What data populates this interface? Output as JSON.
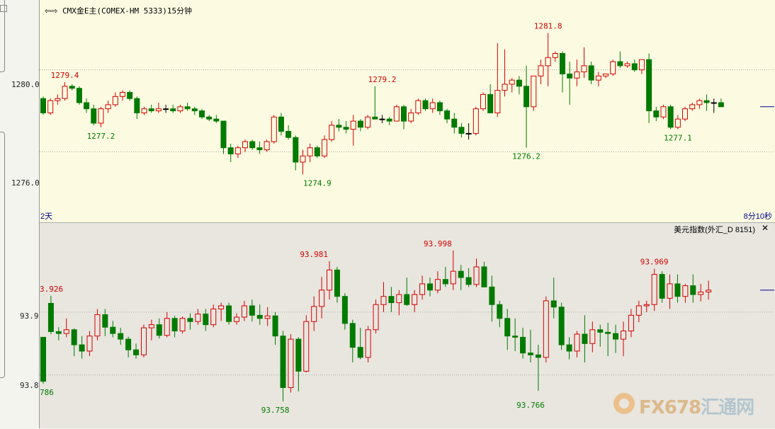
{
  "header": {
    "nav_icon": "left-right-arrows-icon",
    "instrument": "CMX金E主(COMEX-HM 5333)15分钟",
    "period_left": "2天",
    "countdown": "8分10秒"
  },
  "subchart": {
    "title": "美元指数(外汇_D 8151)",
    "close_icon": "close-icon"
  },
  "watermark": {
    "text_a": "FX678",
    "text_b": "汇通网"
  },
  "colors": {
    "up": "#d40000",
    "down": "#007a00",
    "grid": "#aaaaaa",
    "lastline": "#00008b"
  },
  "chart_data": [
    {
      "type": "candlestick",
      "name": "CMX金E主",
      "y_ticks": [
        "1280.0",
        "1276.0"
      ],
      "y_tick_values": [
        1280.0,
        1276.0
      ],
      "ylim": [
        1273.6,
        1283.2
      ],
      "grid": true,
      "annotations": [
        {
          "text": "1279.4",
          "index": 3,
          "value": 1279.4,
          "kind": "high"
        },
        {
          "text": "1277.2",
          "index": 8,
          "value": 1277.2,
          "kind": "low"
        },
        {
          "text": "1274.9",
          "index": 38,
          "value": 1274.9,
          "kind": "low"
        },
        {
          "text": "1279.2",
          "index": 47,
          "value": 1279.2,
          "kind": "high"
        },
        {
          "text": "1276.2",
          "index": 67,
          "value": 1276.2,
          "kind": "low"
        },
        {
          "text": "1281.8",
          "index": 70,
          "value": 1281.8,
          "kind": "high"
        },
        {
          "text": "1277.1",
          "index": 88,
          "value": 1277.1,
          "kind": "low"
        }
      ],
      "ohlc": [
        [
          1278.6,
          1278.7,
          1277.8,
          1277.9
        ],
        [
          1277.9,
          1278.6,
          1277.8,
          1278.5
        ],
        [
          1278.5,
          1278.8,
          1278.3,
          1278.6
        ],
        [
          1278.6,
          1279.4,
          1278.5,
          1279.2
        ],
        [
          1279.2,
          1279.3,
          1279.0,
          1279.1
        ],
        [
          1279.1,
          1279.2,
          1278.3,
          1278.4
        ],
        [
          1278.4,
          1278.6,
          1277.9,
          1278.1
        ],
        [
          1278.1,
          1278.3,
          1277.3,
          1277.4
        ],
        [
          1277.4,
          1278.2,
          1277.2,
          1278.1
        ],
        [
          1278.1,
          1278.5,
          1277.9,
          1278.3
        ],
        [
          1278.3,
          1278.9,
          1278.2,
          1278.7
        ],
        [
          1278.7,
          1279.0,
          1278.5,
          1278.9
        ],
        [
          1278.9,
          1279.0,
          1278.5,
          1278.6
        ],
        [
          1278.6,
          1278.7,
          1277.6,
          1277.9
        ],
        [
          1277.9,
          1278.2,
          1277.8,
          1278.1
        ],
        [
          1278.1,
          1278.3,
          1277.9,
          1278.0
        ],
        [
          1278.0,
          1278.4,
          1277.9,
          1278.1
        ],
        [
          1278.1,
          1278.3,
          1277.9,
          1278.1
        ],
        [
          1278.1,
          1278.3,
          1277.9,
          1278.0
        ],
        [
          1278.0,
          1278.3,
          1277.9,
          1278.2
        ],
        [
          1278.2,
          1278.4,
          1278.0,
          1278.1
        ],
        [
          1278.1,
          1278.2,
          1277.8,
          1278.0
        ],
        [
          1278.0,
          1278.1,
          1277.6,
          1277.7
        ],
        [
          1277.7,
          1277.8,
          1277.5,
          1277.6
        ],
        [
          1277.6,
          1277.8,
          1277.4,
          1277.5
        ],
        [
          1277.5,
          1277.5,
          1275.9,
          1276.2
        ],
        [
          1276.2,
          1276.4,
          1275.5,
          1275.9
        ],
        [
          1275.9,
          1276.3,
          1275.7,
          1276.2
        ],
        [
          1276.2,
          1276.6,
          1276.0,
          1276.5
        ],
        [
          1276.5,
          1276.6,
          1276.1,
          1276.2
        ],
        [
          1276.2,
          1276.5,
          1275.9,
          1276.1
        ],
        [
          1276.1,
          1276.6,
          1276.0,
          1276.5
        ],
        [
          1276.5,
          1277.8,
          1276.4,
          1277.7
        ],
        [
          1277.7,
          1277.9,
          1276.8,
          1277.0
        ],
        [
          1277.0,
          1277.3,
          1276.6,
          1276.7
        ],
        [
          1276.7,
          1276.8,
          1275.1,
          1275.5
        ],
        [
          1275.5,
          1276.1,
          1274.9,
          1275.8
        ],
        [
          1275.8,
          1276.4,
          1275.5,
          1276.2
        ],
        [
          1276.2,
          1276.3,
          1275.7,
          1275.8
        ],
        [
          1275.8,
          1276.8,
          1275.7,
          1276.6
        ],
        [
          1276.6,
          1277.5,
          1276.5,
          1277.3
        ],
        [
          1277.3,
          1277.6,
          1277.0,
          1277.2
        ],
        [
          1277.2,
          1277.5,
          1276.9,
          1277.1
        ],
        [
          1277.1,
          1277.8,
          1276.3,
          1277.5
        ],
        [
          1277.5,
          1277.6,
          1277.0,
          1277.2
        ],
        [
          1277.2,
          1277.8,
          1277.1,
          1277.7
        ],
        [
          1277.7,
          1279.2,
          1277.6,
          1277.6
        ],
        [
          1277.6,
          1277.8,
          1277.4,
          1277.6
        ],
        [
          1277.6,
          1277.7,
          1277.3,
          1277.5
        ],
        [
          1277.5,
          1278.3,
          1277.5,
          1278.2
        ],
        [
          1278.2,
          1278.3,
          1277.1,
          1277.5
        ],
        [
          1277.5,
          1278.1,
          1277.4,
          1277.9
        ],
        [
          1277.9,
          1278.6,
          1277.8,
          1278.5
        ],
        [
          1278.5,
          1278.6,
          1278.0,
          1278.1
        ],
        [
          1278.1,
          1278.6,
          1277.9,
          1278.4
        ],
        [
          1278.4,
          1278.5,
          1277.8,
          1278.0
        ],
        [
          1278.0,
          1278.1,
          1277.4,
          1277.6
        ],
        [
          1277.6,
          1277.9,
          1276.9,
          1277.2
        ],
        [
          1277.2,
          1277.4,
          1276.7,
          1276.9
        ],
        [
          1276.9,
          1277.4,
          1276.6,
          1276.9
        ],
        [
          1276.9,
          1278.2,
          1276.8,
          1278.1
        ],
        [
          1278.1,
          1278.9,
          1278.0,
          1278.8
        ],
        [
          1278.8,
          1279.3,
          1278.0,
          1277.9
        ],
        [
          1277.9,
          1281.3,
          1277.7,
          1279.0
        ],
        [
          1279.0,
          1281.0,
          1278.7,
          1279.3
        ],
        [
          1279.3,
          1279.6,
          1278.9,
          1279.5
        ],
        [
          1279.5,
          1279.7,
          1278.8,
          1279.2
        ],
        [
          1279.2,
          1280.2,
          1276.2,
          1278.2
        ],
        [
          1278.2,
          1279.6,
          1278.0,
          1279.7
        ],
        [
          1279.7,
          1280.5,
          1279.3,
          1280.2
        ],
        [
          1280.2,
          1281.8,
          1279.2,
          1280.6
        ],
        [
          1280.6,
          1280.9,
          1280.4,
          1280.8
        ],
        [
          1280.8,
          1280.9,
          1278.9,
          1279.8
        ],
        [
          1279.8,
          1280.4,
          1278.3,
          1279.6
        ],
        [
          1279.6,
          1280.5,
          1279.2,
          1279.9
        ],
        [
          1279.9,
          1281.1,
          1279.6,
          1280.2
        ],
        [
          1280.2,
          1280.4,
          1279.3,
          1279.5
        ],
        [
          1279.5,
          1279.9,
          1279.2,
          1279.7
        ],
        [
          1279.7,
          1279.8,
          1279.6,
          1279.8
        ],
        [
          1279.8,
          1280.5,
          1279.7,
          1280.4
        ],
        [
          1280.4,
          1280.9,
          1280.1,
          1280.2
        ],
        [
          1280.2,
          1280.4,
          1280.1,
          1280.3
        ],
        [
          1280.3,
          1280.5,
          1279.9,
          1280.0
        ],
        [
          1280.0,
          1280.5,
          1279.8,
          1280.5
        ],
        [
          1280.5,
          1280.8,
          1277.4,
          1278.0
        ],
        [
          1278.0,
          1278.2,
          1277.5,
          1277.7
        ],
        [
          1277.7,
          1278.3,
          1277.6,
          1278.2
        ],
        [
          1278.2,
          1278.3,
          1277.1,
          1277.2
        ],
        [
          1277.2,
          1277.8,
          1277.1,
          1277.6
        ],
        [
          1277.6,
          1278.2,
          1277.5,
          1278.1
        ],
        [
          1278.1,
          1278.4,
          1278.0,
          1278.3
        ],
        [
          1278.3,
          1278.6,
          1278.1,
          1278.5
        ],
        [
          1278.5,
          1278.8,
          1278.0,
          1278.4
        ],
        [
          1278.4,
          1278.6,
          1277.9,
          1278.4
        ],
        [
          1278.4,
          1278.6,
          1278.2,
          1278.2
        ]
      ]
    },
    {
      "type": "candlestick",
      "name": "美元指数",
      "y_ticks": [
        "93.9",
        "93.8"
      ],
      "y_tick_values": [
        93.9,
        93.8
      ],
      "ylim": [
        93.74,
        94.035
      ],
      "grid": true,
      "annotations": [
        {
          "text": "3.926",
          "index": 0,
          "value": 93.926,
          "kind": "high"
        },
        {
          "text": "786",
          "index": 0,
          "value": 93.786,
          "kind": "low"
        },
        {
          "text": "93.981",
          "index": 35,
          "value": 93.981,
          "kind": "high"
        },
        {
          "text": "93.758",
          "index": 30,
          "value": 93.758,
          "kind": "low"
        },
        {
          "text": "93.998",
          "index": 51,
          "value": 93.998,
          "kind": "high"
        },
        {
          "text": "93.766",
          "index": 63,
          "value": 93.766,
          "kind": "low"
        },
        {
          "text": "93.969",
          "index": 79,
          "value": 93.969,
          "kind": "high"
        }
      ],
      "ohlc": [
        [
          93.86,
          93.86,
          93.786,
          93.79
        ],
        [
          93.914,
          93.926,
          93.865,
          93.869
        ],
        [
          93.869,
          93.876,
          93.855,
          93.866
        ],
        [
          93.866,
          93.89,
          93.86,
          93.872
        ],
        [
          93.872,
          93.874,
          93.83,
          93.848
        ],
        [
          93.848,
          93.862,
          93.826,
          93.838
        ],
        [
          93.838,
          93.87,
          93.83,
          93.862
        ],
        [
          93.862,
          93.905,
          93.855,
          93.896
        ],
        [
          93.896,
          93.905,
          93.862,
          93.876
        ],
        [
          93.876,
          93.886,
          93.86,
          93.866
        ],
        [
          93.866,
          93.875,
          93.848,
          93.857
        ],
        [
          93.857,
          93.861,
          93.828,
          93.84
        ],
        [
          93.84,
          93.85,
          93.826,
          93.832
        ],
        [
          93.832,
          93.88,
          93.828,
          93.875
        ],
        [
          93.875,
          93.888,
          93.855,
          93.88
        ],
        [
          93.88,
          93.89,
          93.858,
          93.863
        ],
        [
          93.863,
          93.9,
          93.86,
          93.89
        ],
        [
          93.89,
          93.894,
          93.86,
          93.87
        ],
        [
          93.87,
          93.893,
          93.866,
          93.89
        ],
        [
          93.89,
          93.898,
          93.872,
          93.885
        ],
        [
          93.885,
          93.905,
          93.88,
          93.897
        ],
        [
          93.897,
          93.905,
          93.87,
          93.88
        ],
        [
          93.88,
          93.912,
          93.876,
          93.905
        ],
        [
          93.905,
          93.915,
          93.886,
          93.91
        ],
        [
          93.91,
          93.915,
          93.88,
          93.885
        ],
        [
          93.885,
          93.898,
          93.88,
          93.892
        ],
        [
          93.892,
          93.918,
          93.886,
          93.91
        ],
        [
          93.91,
          93.92,
          93.885,
          93.895
        ],
        [
          93.895,
          93.912,
          93.88,
          93.89
        ],
        [
          93.89,
          93.908,
          93.878,
          93.894
        ],
        [
          93.894,
          93.9,
          93.848,
          93.862
        ],
        [
          93.862,
          93.87,
          93.758,
          93.78
        ],
        [
          93.78,
          93.865,
          93.772,
          93.857
        ],
        [
          93.857,
          93.86,
          93.774,
          93.806
        ],
        [
          93.806,
          93.895,
          93.804,
          93.885
        ],
        [
          93.885,
          93.925,
          93.87,
          93.909
        ],
        [
          93.909,
          93.956,
          93.89,
          93.935
        ],
        [
          93.935,
          93.981,
          93.92,
          93.967
        ],
        [
          93.967,
          93.972,
          93.915,
          93.925
        ],
        [
          93.925,
          93.93,
          93.872,
          93.882
        ],
        [
          93.882,
          93.888,
          93.82,
          93.844
        ],
        [
          93.844,
          93.875,
          93.825,
          93.828
        ],
        [
          93.828,
          93.878,
          93.82,
          93.872
        ],
        [
          93.872,
          93.92,
          93.866,
          93.912
        ],
        [
          93.912,
          93.948,
          93.9,
          93.925
        ],
        [
          93.925,
          93.94,
          93.9,
          93.915
        ],
        [
          93.915,
          93.935,
          93.895,
          93.928
        ],
        [
          93.928,
          93.955,
          93.91,
          93.912
        ],
        [
          93.912,
          93.935,
          93.9,
          93.928
        ],
        [
          93.928,
          93.958,
          93.92,
          93.945
        ],
        [
          93.945,
          93.955,
          93.925,
          93.935
        ],
        [
          93.935,
          93.965,
          93.93,
          93.952
        ],
        [
          93.952,
          93.972,
          93.94,
          93.945
        ],
        [
          93.945,
          93.998,
          93.935,
          93.965
        ],
        [
          93.965,
          93.975,
          93.935,
          93.955
        ],
        [
          93.955,
          93.97,
          93.94,
          93.944
        ],
        [
          93.944,
          93.985,
          93.94,
          93.972
        ],
        [
          93.972,
          93.98,
          93.95,
          93.94
        ],
        [
          93.94,
          93.958,
          93.885,
          93.912
        ],
        [
          93.912,
          93.918,
          93.876,
          93.89
        ],
        [
          93.89,
          93.905,
          93.84,
          93.862
        ],
        [
          93.862,
          93.89,
          93.838,
          93.86
        ],
        [
          93.86,
          93.875,
          93.826,
          93.835
        ],
        [
          93.835,
          93.872,
          93.82,
          93.832
        ],
        [
          93.832,
          93.848,
          93.775,
          93.828
        ],
        [
          93.828,
          93.925,
          93.82,
          93.918
        ],
        [
          93.918,
          93.955,
          93.89,
          93.908
        ],
        [
          93.908,
          93.915,
          93.84,
          93.848
        ],
        [
          93.848,
          93.86,
          93.825,
          93.838
        ],
        [
          93.838,
          93.87,
          93.828,
          93.865
        ],
        [
          93.865,
          93.895,
          93.82,
          93.85
        ],
        [
          93.85,
          93.885,
          93.836,
          93.872
        ],
        [
          93.872,
          93.88,
          93.845,
          93.868
        ],
        [
          93.868,
          93.883,
          93.83,
          93.866
        ],
        [
          93.866,
          93.88,
          93.835,
          93.857
        ],
        [
          93.857,
          93.885,
          93.83,
          93.87
        ],
        [
          93.87,
          93.905,
          93.86,
          93.895
        ],
        [
          93.895,
          93.918,
          93.884,
          93.91
        ],
        [
          93.91,
          93.918,
          93.9,
          93.912
        ],
        [
          93.912,
          93.969,
          93.902,
          93.96
        ],
        [
          93.96,
          93.965,
          93.915,
          93.922
        ],
        [
          93.922,
          93.96,
          93.905,
          93.945
        ],
        [
          93.945,
          93.96,
          93.915,
          93.925
        ],
        [
          93.925,
          93.945,
          93.915,
          93.942
        ],
        [
          93.942,
          93.96,
          93.915,
          93.928
        ],
        [
          93.928,
          93.945,
          93.917,
          93.932
        ],
        [
          93.932,
          93.95,
          93.92,
          93.935
        ]
      ]
    }
  ]
}
